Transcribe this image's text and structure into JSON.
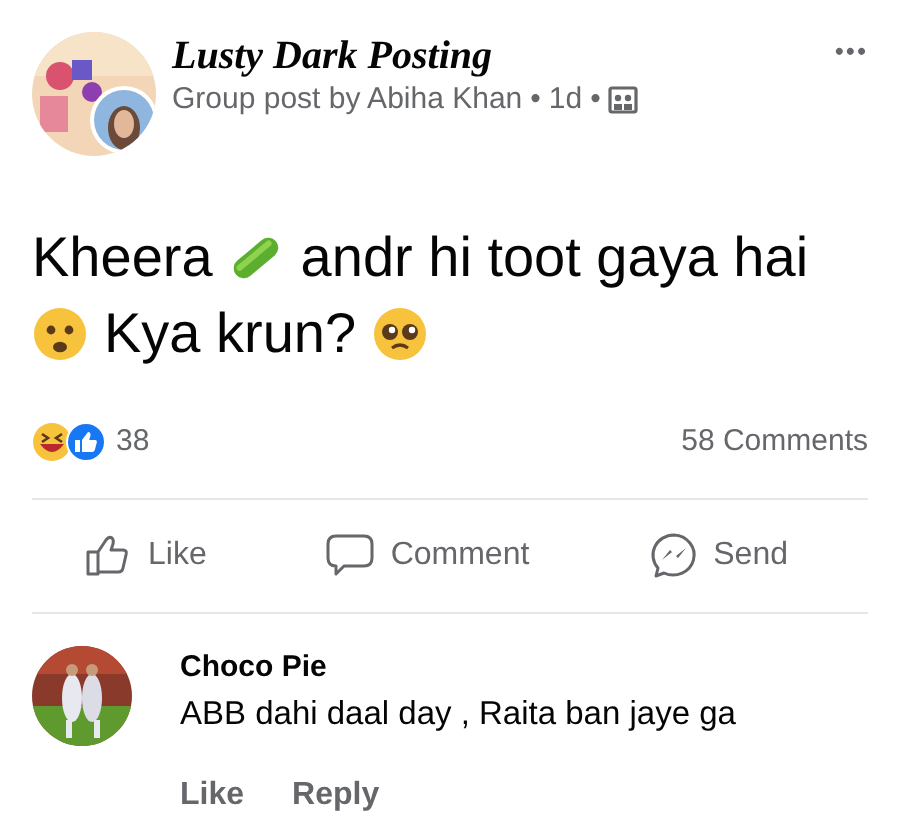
{
  "post": {
    "group_name": "Lusty Dark Posting",
    "byline": "Group post by Abiha Khan",
    "dot_1": "•",
    "time": "1d",
    "dot_2": "•",
    "more": "•••",
    "text_parts": [
      "Kheera",
      "andr hi toot gaya hai",
      "Kya krun?"
    ],
    "reaction_count": "38",
    "comments_count": "58 Comments",
    "actions": [
      "Like",
      "Comment",
      "Send"
    ]
  },
  "comments": [
    {
      "author": "Choco Pie",
      "text": "ABB dahi daal day , Raita ban jaye ga",
      "actions": [
        "Like",
        "Reply"
      ]
    }
  ]
}
